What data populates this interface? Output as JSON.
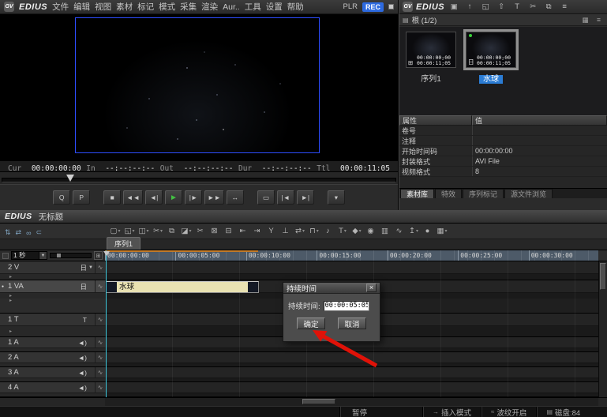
{
  "colors": {
    "accent_blue": "#2d6ae0",
    "selection_blue": "#2b7cd4",
    "clip_yellow": "#e9e2b2",
    "play_green": "#43c043",
    "frame_blue": "#2d4dff",
    "arrow_red": "#e01208",
    "ruler_orange": "#c27a28"
  },
  "monitor": {
    "logo_text": "GV",
    "app_name": "EDIUS",
    "menus": [
      "文件",
      "编辑",
      "视图",
      "素材",
      "标记",
      "模式",
      "采集",
      "渲染",
      "Aur..",
      "工具",
      "设置",
      "帮助"
    ],
    "plr_label": "PLR",
    "rec_label": "REC",
    "timecodes": [
      {
        "label": "Cur",
        "value": "00:00:00:00"
      },
      {
        "label": "In",
        "value": "--:--:--:--"
      },
      {
        "label": "Out",
        "value": "--:--:--:--"
      },
      {
        "label": "Dur",
        "value": "--:--:--:--"
      },
      {
        "label": "Ttl",
        "value": "00:00:11:05"
      }
    ],
    "transport": [
      {
        "name": "button-q",
        "glyph": "Q",
        "group_end": false
      },
      {
        "name": "button-p",
        "glyph": "P",
        "group_end": true
      },
      {
        "name": "stop-button",
        "glyph": "■"
      },
      {
        "name": "rewind-button",
        "glyph": "◄◄"
      },
      {
        "name": "step-back-button",
        "glyph": "◄|"
      },
      {
        "name": "play-button",
        "glyph": "►",
        "green": true
      },
      {
        "name": "step-forward-button",
        "glyph": "|►"
      },
      {
        "name": "fast-forward-button",
        "glyph": "►►"
      },
      {
        "name": "loop-button",
        "glyph": "↔",
        "group_end": true
      },
      {
        "name": "display-mode-button",
        "glyph": "▭"
      },
      {
        "name": "prev-edit-button",
        "glyph": "|◄"
      },
      {
        "name": "next-edit-button",
        "glyph": "►|",
        "group_end": true
      },
      {
        "name": "player-menu-button",
        "glyph": "▾"
      }
    ]
  },
  "bin": {
    "app_name": "EDIUS",
    "logo_text": "GV",
    "title_icons": [
      {
        "name": "new-folder-icon",
        "glyph": "▣"
      },
      {
        "name": "up-folder-icon",
        "glyph": "↑"
      },
      {
        "name": "capture-icon",
        "glyph": "◱"
      },
      {
        "name": "import-icon",
        "glyph": "⇧"
      },
      {
        "name": "title-text-icon",
        "glyph": "T"
      },
      {
        "name": "cut-icon",
        "glyph": "✂"
      },
      {
        "name": "copy-icon",
        "glyph": "⧉"
      },
      {
        "name": "list-menu-icon",
        "glyph": "≡"
      }
    ],
    "breadcrumb_icon": "▤",
    "breadcrumb_label": "根 (1/2)",
    "view_icons": [
      {
        "name": "grid-view-icon",
        "glyph": "▦"
      },
      {
        "name": "bin-menu-icon",
        "glyph": "≡"
      }
    ],
    "clips": [
      {
        "name": "序列1",
        "tc_in": "00:00:00;00",
        "tc_dur": "00:00:11;05",
        "badge": "⊞",
        "selected": false
      },
      {
        "name": "水球",
        "tc_in": "00:00:00;00",
        "tc_dur": "00:00:11;05",
        "badge": "日",
        "selected": true
      }
    ],
    "properties": {
      "key_header": "属性",
      "value_header": "值",
      "rows": [
        {
          "key": "卷号",
          "value": ""
        },
        {
          "key": "注释",
          "value": ""
        },
        {
          "key": "开始时间码",
          "value": "00:00:00:00"
        },
        {
          "key": "封装格式",
          "value": "AVI File"
        },
        {
          "key": "视频格式",
          "value": "8"
        }
      ]
    },
    "tabs": [
      {
        "label": "素材库",
        "active": true
      },
      {
        "label": "特效",
        "active": false
      },
      {
        "label": "序列标记",
        "active": false
      },
      {
        "label": "源文件浏览",
        "active": false
      }
    ]
  },
  "timeline": {
    "app_name": "EDIUS",
    "doc_title": "无标题",
    "patch_icons": [
      {
        "name": "video-patch-icon",
        "glyph": "⇅"
      },
      {
        "name": "audio-patch-icon",
        "glyph": "⇄"
      },
      {
        "name": "sync-lock-icon",
        "glyph": "∞"
      },
      {
        "name": "channel-map-icon",
        "glyph": "⊂"
      }
    ],
    "toolbar": [
      {
        "name": "new-sequence-icon",
        "glyph": "▢",
        "drop": "▾"
      },
      {
        "name": "open-project-icon",
        "glyph": "◱",
        "drop": "▾"
      },
      {
        "name": "save-icon",
        "glyph": "◫",
        "drop": "▾"
      },
      {
        "name": "cut-icon",
        "glyph": "✂",
        "drop": "▾"
      },
      {
        "name": "copy-icon",
        "glyph": "⧉",
        "drop": ""
      },
      {
        "name": "paste-icon",
        "glyph": "◪",
        "drop": "▾"
      },
      {
        "name": "ripple-cut-icon",
        "glyph": "✂",
        "drop": ""
      },
      {
        "name": "delete-icon",
        "glyph": "⊠",
        "drop": ""
      },
      {
        "name": "ripple-delete-icon",
        "glyph": "⊟",
        "drop": ""
      },
      {
        "name": "set-in-icon",
        "glyph": "⇤",
        "drop": ""
      },
      {
        "name": "set-out-icon",
        "glyph": "⇥",
        "drop": ""
      },
      {
        "name": "add-cut-point-icon",
        "glyph": "Y",
        "drop": ""
      },
      {
        "name": "remove-cut-point-icon",
        "glyph": "⊥",
        "drop": ""
      },
      {
        "name": "edit-mode-icon",
        "glyph": "⇄",
        "drop": "▾"
      },
      {
        "name": "transition-icon",
        "glyph": "⊓",
        "drop": "▾"
      },
      {
        "name": "audio-fade-icon",
        "glyph": "♪",
        "drop": ""
      },
      {
        "name": "title-icon",
        "glyph": "T",
        "drop": "▾"
      },
      {
        "name": "marker-icon",
        "glyph": "◆",
        "drop": "▾"
      },
      {
        "name": "match-frame-icon",
        "glyph": "◉",
        "drop": ""
      },
      {
        "name": "mixer-icon",
        "glyph": "▥",
        "drop": ""
      },
      {
        "name": "normalize-icon",
        "glyph": "∿",
        "drop": ""
      },
      {
        "name": "export-icon",
        "glyph": "↥",
        "drop": "▾"
      },
      {
        "name": "record-icon",
        "glyph": "●",
        "drop": ""
      },
      {
        "name": "layout-icon",
        "glyph": "▦",
        "drop": "▾"
      }
    ],
    "sequence_tab": "序列1",
    "zoom": {
      "value": "1 秒",
      "drop": "▼",
      "fit": "⊞"
    },
    "ruler_labels": [
      "00:00:00:00",
      "00:00:05:00",
      "00:00:10:00",
      "00:00:15:00",
      "00:00:20:00",
      "00:00:25:00",
      "00:00:30:00"
    ],
    "tracks": [
      {
        "label": "2 V",
        "icon": "日",
        "kind": "v",
        "drop_glyph": "▼",
        "wave": "∿",
        "dot": "",
        "exp": "▸",
        "active": false
      },
      {
        "label": "1 VA",
        "icon": "日",
        "kind": "va",
        "drop_glyph": "",
        "wave": "∿",
        "dot": "●",
        "exp": "▸",
        "active": true
      },
      {
        "label": "1 T",
        "icon": "T",
        "kind": "t",
        "drop_glyph": "",
        "wave": "∿",
        "dot": "",
        "exp": "▸",
        "active": false
      },
      {
        "label": "1 A",
        "icon": "◄)",
        "kind": "a",
        "drop_glyph": "",
        "wave": "∿",
        "dot": "",
        "exp": "▸",
        "active": false
      },
      {
        "label": "2 A",
        "icon": "◄)",
        "kind": "a",
        "drop_glyph": "",
        "wave": "∿",
        "dot": "",
        "exp": "▸",
        "active": false
      },
      {
        "label": "3 A",
        "icon": "◄)",
        "kind": "a",
        "drop_glyph": "",
        "wave": "∿",
        "dot": "",
        "exp": "▸",
        "active": false
      },
      {
        "label": "4 A",
        "icon": "◄)",
        "kind": "a",
        "drop_glyph": "",
        "wave": "∿",
        "dot": "",
        "exp": "▸",
        "active": false
      }
    ],
    "clip_name": "水球"
  },
  "dialog": {
    "title": "持续时间",
    "close_glyph": "×",
    "field_label": "持续时间:",
    "field_value": "00:00:05:05",
    "ok_label": "确定",
    "cancel_label": "取消"
  },
  "statusbar": {
    "items": [
      {
        "name": "status-pause",
        "icon": "",
        "label": "暂停",
        "wide": true
      },
      {
        "name": "status-insert-mode",
        "icon": "→",
        "label": "插入模式"
      },
      {
        "name": "status-ripple",
        "icon": "≈",
        "label": "波纹开启"
      },
      {
        "name": "status-disk",
        "icon": "▤",
        "label": "磁盘:84"
      }
    ]
  }
}
